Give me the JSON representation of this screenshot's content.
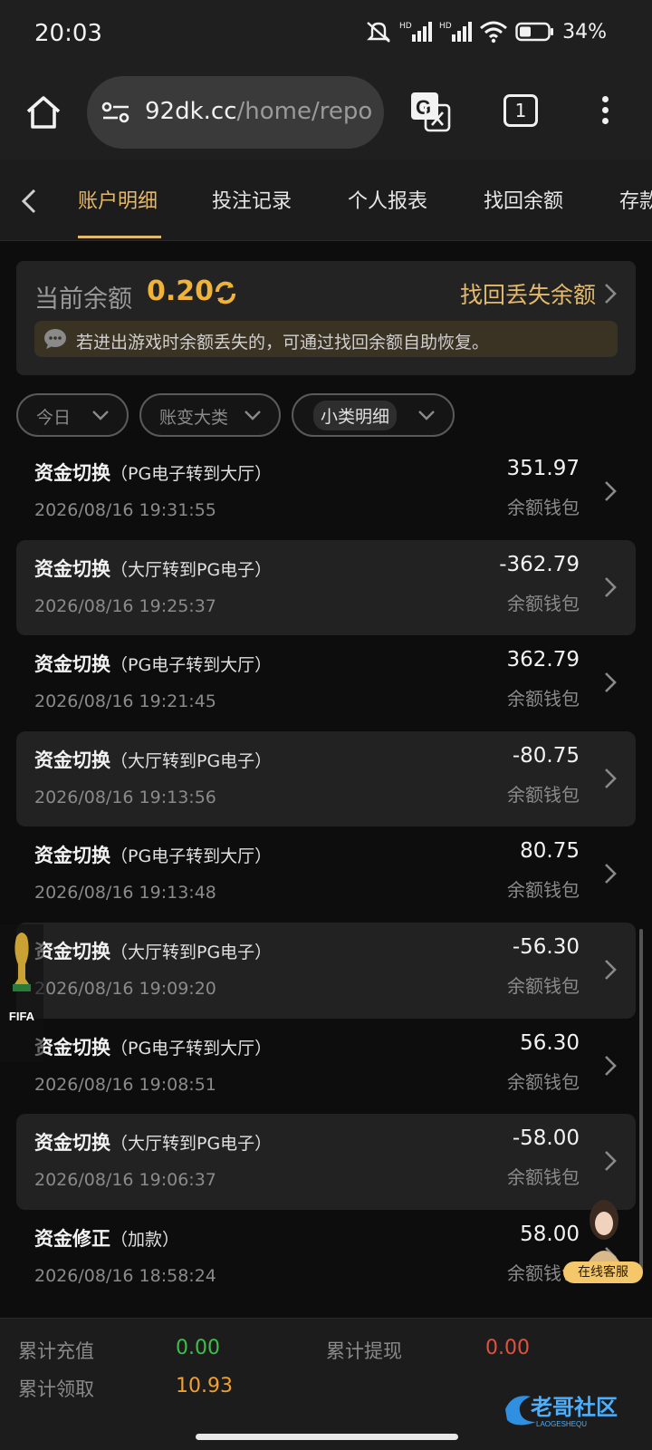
{
  "status_bar": {
    "time": "20:03",
    "battery": "34%",
    "hd1": "HD",
    "hd2": "HD"
  },
  "browser": {
    "url_host": "92dk.cc",
    "url_path": "/home/report",
    "tab_count": "1"
  },
  "tabs": [
    {
      "label": "账户明细",
      "active": true
    },
    {
      "label": "投注记录",
      "active": false
    },
    {
      "label": "个人报表",
      "active": false
    },
    {
      "label": "找回余额",
      "active": false
    },
    {
      "label": "存款",
      "active": false
    }
  ],
  "balance": {
    "label": "当前余额",
    "value": "0.20",
    "recover_link": "找回丢失余额",
    "notice": "若进出游戏时余额丢失的，可通过找回余额自助恢复。"
  },
  "filters": [
    {
      "label": "今日"
    },
    {
      "label": "账变大类"
    },
    {
      "label": "小类明细"
    }
  ],
  "transactions": [
    {
      "title": "资金切换",
      "sub": "（PG电子转到大厅）",
      "date": "2026/08/16 19:31:55",
      "amount": "351.97",
      "wallet": "余额钱包"
    },
    {
      "title": "资金切换",
      "sub": "（大厅转到PG电子）",
      "date": "2026/08/16 19:25:37",
      "amount": "-362.79",
      "wallet": "余额钱包"
    },
    {
      "title": "资金切换",
      "sub": "（PG电子转到大厅）",
      "date": "2026/08/16 19:21:45",
      "amount": "362.79",
      "wallet": "余额钱包"
    },
    {
      "title": "资金切换",
      "sub": "（大厅转到PG电子）",
      "date": "2026/08/16 19:13:56",
      "amount": "-80.75",
      "wallet": "余额钱包"
    },
    {
      "title": "资金切换",
      "sub": "（PG电子转到大厅）",
      "date": "2026/08/16 19:13:48",
      "amount": "80.75",
      "wallet": "余额钱包"
    },
    {
      "title": "资金切换",
      "sub": "（大厅转到PG电子）",
      "date": "2026/08/16 19:09:20",
      "amount": "-56.30",
      "wallet": "余额钱包"
    },
    {
      "title": "资金切换",
      "sub": "（PG电子转到大厅）",
      "date": "2026/08/16 19:08:51",
      "amount": "56.30",
      "wallet": "余额钱包"
    },
    {
      "title": "资金切换",
      "sub": "（大厅转到PG电子）",
      "date": "2026/08/16 19:06:37",
      "amount": "-58.00",
      "wallet": "余额钱包"
    },
    {
      "title": "资金修正",
      "sub": "（加款）",
      "date": "2026/08/16 18:58:24",
      "amount": "58.00",
      "wallet": "余额钱包"
    }
  ],
  "footer": {
    "deposit_label": "累计充值",
    "deposit_value": "0.00",
    "withdraw_label": "累计提现",
    "withdraw_value": "0.00",
    "claim_label": "累计领取",
    "claim_value": "10.93",
    "brand": "老哥社区",
    "brand_sub": "LAOGESHEQU"
  },
  "overlays": {
    "fifa": "FIFA",
    "support": "在线客服"
  },
  "colors": {
    "accent": "#e3b96b",
    "balance": "#f0b33a",
    "green": "#3fbf4a",
    "red": "#e0523e",
    "orange": "#f0a030"
  }
}
